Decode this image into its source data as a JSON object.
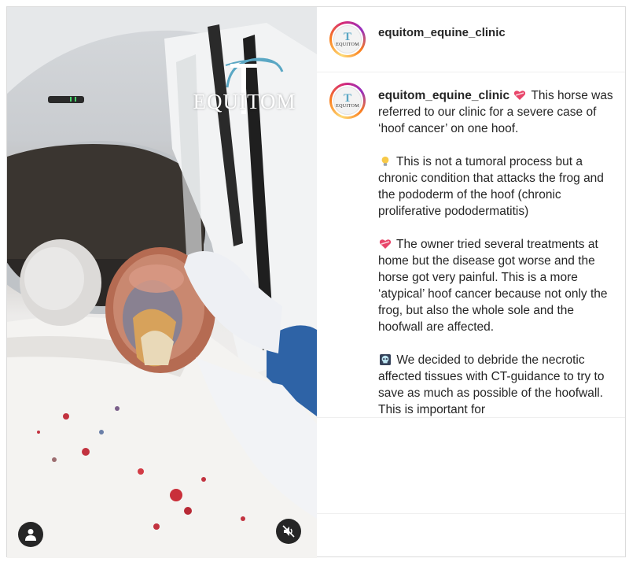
{
  "post": {
    "username": "equitom_equine_clinic",
    "logo_word": "EQUITOM",
    "logo_letter": "T"
  },
  "caption": {
    "username": "equitom_equine_clinic",
    "paragraph_1": "This horse was referred to our clinic for a severe case of ‘hoof cancer’ on one hoof.",
    "paragraph_2": "This is not a tumoral process but a chronic condition that attacks the frog and the pododerm of the hoof (chronic proliferative pododermatitis)",
    "paragraph_3": "The owner tried several treatments at home but the disease got worse and the horse got very painful. This is a more ‘atypical’ hoof cancer because not only the frog, but also the whole sole and the hoofwall are affected.",
    "paragraph_4": "We decided to debride the necrotic affected tissues with CT-guidance to try to save as much as possible of the hoofwall. This is important for",
    "emoji_1": "heart-with-ribbon",
    "emoji_2": "light-bulb",
    "emoji_3": "heart-with-ribbon",
    "emoji_4": "skull"
  },
  "icons": {
    "user_tag": "person-icon",
    "mute": "speaker-muted-icon"
  },
  "colors": {
    "story_ring": "#d62976",
    "overlay_button": "#262626",
    "logo_accent": "#5aa7c4"
  }
}
